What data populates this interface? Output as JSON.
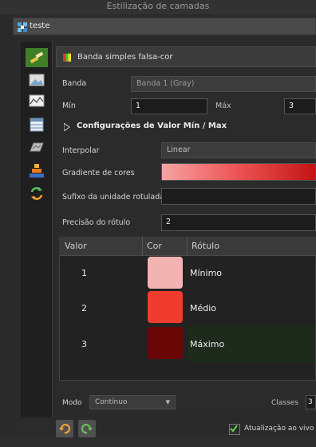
{
  "window": {
    "title": "Estilização de camadas"
  },
  "layer": {
    "name": "teste"
  },
  "renderer": {
    "label": "Banda simples falsa-cor"
  },
  "band": {
    "label": "Banda",
    "value": "Banda 1 (Gray)"
  },
  "min": {
    "label": "Mín",
    "value": "1"
  },
  "max": {
    "label": "Máx",
    "value": "3"
  },
  "minmax_settings": {
    "label": "Configurações de Valor Mín / Max"
  },
  "interpolate": {
    "label": "Interpolar",
    "value": "Linear"
  },
  "color_ramp": {
    "label": "Gradiente de cores"
  },
  "unit_suffix": {
    "label": "Sufixo da unidade rotulada",
    "value": ""
  },
  "label_precision": {
    "label": "Precisão do rótulo",
    "value": "2"
  },
  "table": {
    "headers": [
      "Valor",
      "Cor",
      "Rótulo"
    ],
    "rows": [
      {
        "value": "1",
        "color": "#f4b3b3",
        "label": "Mínimo"
      },
      {
        "value": "2",
        "color": "#f03c2e",
        "label": "Médio"
      },
      {
        "value": "3",
        "color": "#6b0606",
        "label": "Máximo"
      }
    ]
  },
  "mode": {
    "label": "Modo",
    "value": "Contínuo"
  },
  "classes": {
    "label": "Classes",
    "value": "3"
  },
  "live_update": {
    "label": "Atualização ao vivo",
    "checked": true
  },
  "colors": {
    "accent_green": "#3f7f28",
    "ramp_start": "#f6a3a3",
    "ramp_end": "#c41414"
  }
}
